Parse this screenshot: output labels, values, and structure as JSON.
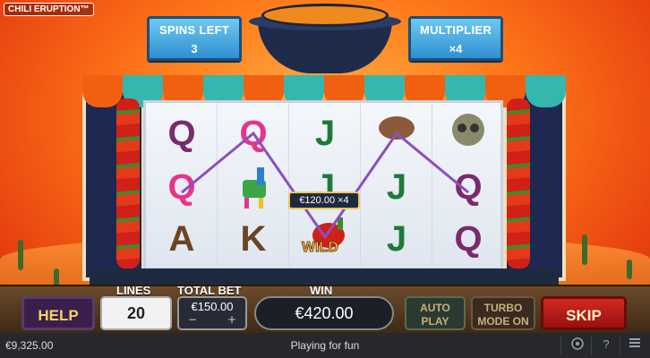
{
  "game": {
    "title": "CHILI ERUPTION™"
  },
  "header": {
    "spins_left": {
      "label": "SPINS LEFT",
      "value": "3"
    },
    "multiplier": {
      "label": "MULTIPLIER",
      "value": "×4"
    }
  },
  "reels": {
    "columns": [
      [
        "Q",
        "Q",
        "A"
      ],
      [
        "Q",
        "llama",
        "K"
      ],
      [
        "J",
        "J",
        "WILD"
      ],
      [
        "steak",
        "J",
        "J"
      ],
      [
        "skull",
        "Q",
        "Q"
      ]
    ],
    "win_badge": "€120.00 ×4",
    "wild_label": "WILD"
  },
  "controls": {
    "help_label": "HELP",
    "lines": {
      "label": "LINES",
      "value": "20"
    },
    "total_bet": {
      "label": "TOTAL BET",
      "value": "€150.00",
      "minus": "−",
      "plus": "+"
    },
    "win": {
      "label": "WIN",
      "value": "€420.00"
    },
    "auto_play_label": "AUTO PLAY",
    "turbo_label": "TURBO MODE ON",
    "skip_label": "SKIP"
  },
  "status_bar": {
    "balance": "€9,325.00",
    "mode": "Playing for fun",
    "help_icon": "?",
    "icons": [
      "sound-icon",
      "help-icon",
      "menu-icon"
    ]
  },
  "colors": {
    "sky": "#ff7a1a",
    "sign_blue": "#2f8fd1",
    "skip_red": "#c01818",
    "gold_text": "#f3d36b",
    "symbol_purple": "#7a2a6a",
    "symbol_pink": "#e8338a",
    "symbol_green": "#1f7a3a",
    "symbol_brown": "#6b4422"
  }
}
